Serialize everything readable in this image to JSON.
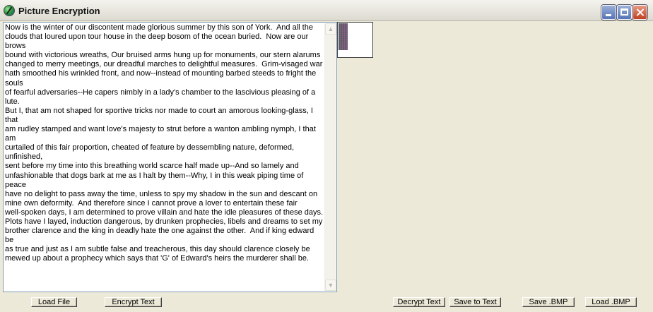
{
  "window": {
    "title": "Picture Encryption",
    "app_icon": "encryption-globe-icon",
    "controls": {
      "minimize": "minimize-icon",
      "maximize": "maximize-icon",
      "close": "close-icon"
    }
  },
  "editor": {
    "text": "Now is the winter of our discontent made glorious summer by this son of York.  And all the\nclouds that loured upon tour house in the deep bosom of the ocean buried.  Now are our brows\nbound with victorious wreaths, Our bruised arms hung up for monuments, our stern alarums\nchanged to merry meetings, our dreadful marches to delightful measures.  Grim-visaged war\nhath smoothed his wrinkled front, and now--instead of mounting barbed steeds to fright the souls\nof fearful adversaries--He capers nimbly in a lady's chamber to the lascivious pleasing of a lute.\nBut I, that am not shaped for sportive tricks nor made to court an amorous looking-glass, I that\nam rudley stamped and want love's majesty to strut before a wanton ambling nymph, I that am\ncurtailed of this fair proportion, cheated of feature by dessembling nature, deformed, unfinished,\nsent before my time into this breathing world scarce half made up--And so lamely and\nunfashionable that dogs bark at me as I halt by them--Why, I in this weak piping time of peace\nhave no delight to pass away the time, unless to spy my shadow in the sun and descant on\nmine own deformity.  And therefore since I cannot prove a lover to entertain these fair\nwell-spoken days, I am determined to prove villain and hate the idle pleasures of these days.\nPlots have I layed, induction dangerous, by drunken prophecies, libels and dreams to set my\nbrother clarence and the king in deadly hate the one against the other.  And if king edward be\nas true and just as I am subtle false and treacherous, this day should clarence closely be\nmewed up about a prophecy which says that 'G' of Edward's heirs the murderer shall be."
  },
  "buttons": {
    "load_file": "Load File",
    "encrypt_text": "Encrypt Text",
    "decrypt_text": "Decrypt Text",
    "save_to_text": "Save to Text",
    "save_bmp": "Save .BMP",
    "load_bmp": "Load .BMP"
  }
}
